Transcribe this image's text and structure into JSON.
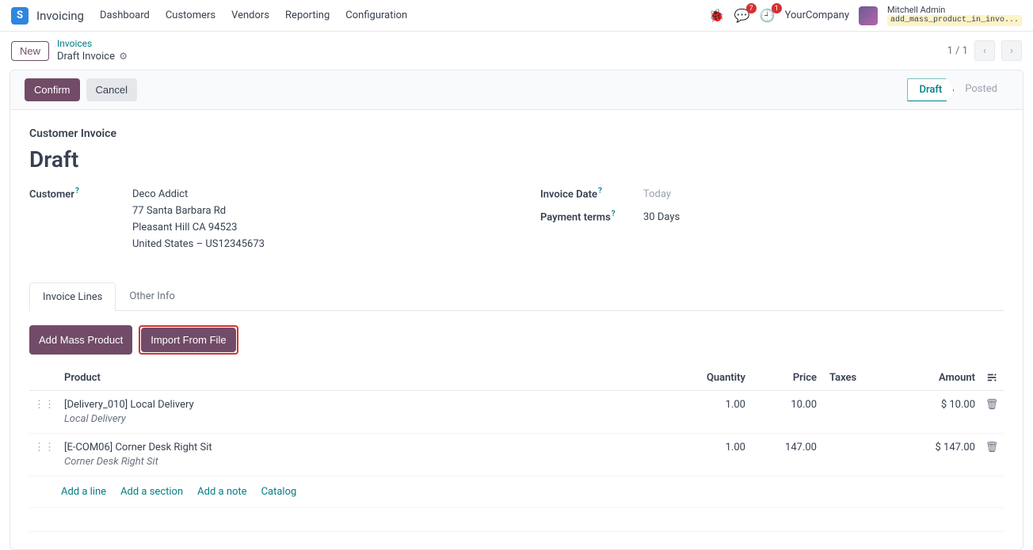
{
  "app": {
    "icon": "S",
    "title": "Invoicing"
  },
  "nav": [
    "Dashboard",
    "Customers",
    "Vendors",
    "Reporting",
    "Configuration"
  ],
  "notifications": {
    "chat_count": "7",
    "activity_count": "1"
  },
  "company": "YourCompany",
  "user": {
    "name": "Mitchell Admin",
    "tag": "add_mass_product_in_invo..."
  },
  "breadcrumb": {
    "parent": "Invoices",
    "current": "Draft Invoice"
  },
  "btn_new": "New",
  "pager": "1 / 1",
  "actions": {
    "confirm": "Confirm",
    "cancel": "Cancel"
  },
  "status": {
    "draft": "Draft",
    "posted": "Posted"
  },
  "form": {
    "section": "Customer Invoice",
    "title": "Draft",
    "customer_label": "Customer",
    "customer_name": "Deco Addict",
    "customer_addr1": "77 Santa Barbara Rd",
    "customer_addr2": "Pleasant Hill CA 94523",
    "customer_addr3": "United States – US12345673",
    "invoice_date_label": "Invoice Date",
    "invoice_date_value": "Today",
    "terms_label": "Payment terms",
    "terms_value": "30 Days"
  },
  "tabs": {
    "lines": "Invoice Lines",
    "other": "Other Info"
  },
  "line_btns": {
    "mass": "Add Mass Product",
    "import": "Import From File"
  },
  "cols": {
    "product": "Product",
    "qty": "Quantity",
    "price": "Price",
    "taxes": "Taxes",
    "amount": "Amount"
  },
  "rows": [
    {
      "product": "[Delivery_010] Local Delivery",
      "desc": "Local Delivery",
      "qty": "1.00",
      "price": "10.00",
      "amount": "$ 10.00"
    },
    {
      "product": "[E-COM06] Corner Desk Right Sit",
      "desc": "Corner Desk Right Sit",
      "qty": "1.00",
      "price": "147.00",
      "amount": "$ 147.00"
    }
  ],
  "footer_links": {
    "add_line": "Add a line",
    "add_section": "Add a section",
    "add_note": "Add a note",
    "catalog": "Catalog"
  }
}
